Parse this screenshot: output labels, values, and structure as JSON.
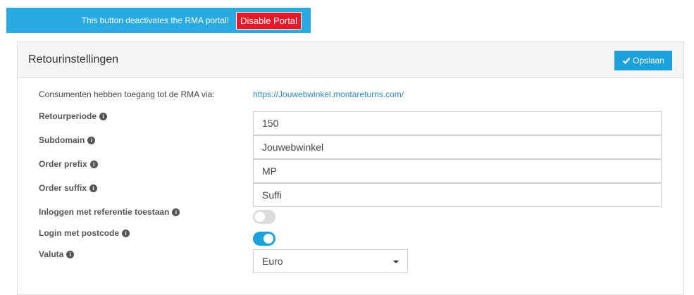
{
  "banner": {
    "text": "This button deactivates the RMA portal!",
    "button_label": "Disable Portal",
    "background_color": "#29abe2",
    "button_color": "#e8182a"
  },
  "panel": {
    "title": "Retourinstellingen",
    "save_label": "Opslaan",
    "save_icon": "check-icon",
    "accent_color": "#1ba1dc"
  },
  "access": {
    "label": "Consumenten hebben toegang tot de RMA via:",
    "url": "https://Jouwebwinkel.montareturns.com/"
  },
  "fields": {
    "retourperiode": {
      "label": "Retourperiode",
      "value": "150"
    },
    "subdomain": {
      "label": "Subdomain",
      "value": "Jouwebwinkel"
    },
    "order_prefix": {
      "label": "Order prefix",
      "value": "MP"
    },
    "order_suffix": {
      "label": "Order suffix",
      "value": "Suffi"
    },
    "login_reference": {
      "label": "Inloggen met referentie toestaan",
      "enabled": false
    },
    "login_postcode": {
      "label": "Login met postcode",
      "enabled": true
    },
    "valuta": {
      "label": "Valuta",
      "selected": "Euro"
    }
  },
  "info_icon_glyph": "i"
}
